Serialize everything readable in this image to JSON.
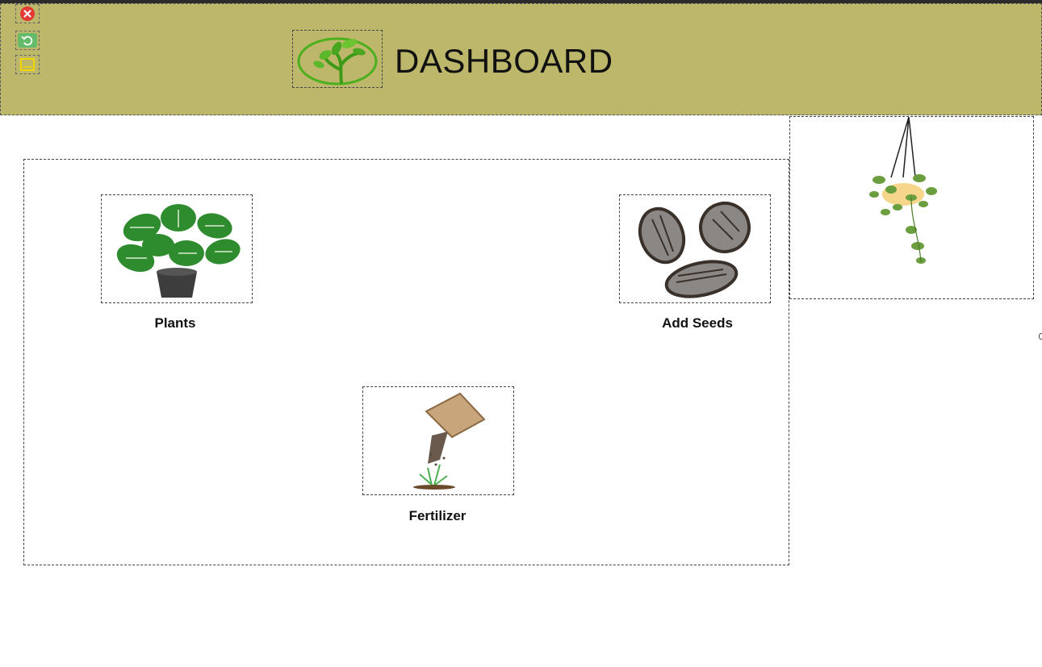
{
  "header": {
    "title": "DASHBOARD",
    "bg_color": "#bdb76c"
  },
  "window_controls": [
    {
      "name": "close-icon",
      "color": "#e53935"
    },
    {
      "name": "refresh-icon",
      "color": "#66bb6a"
    },
    {
      "name": "minimize-icon",
      "color": "#f2d600"
    }
  ],
  "tiles": [
    {
      "label": "Plants",
      "icon": "potted-plant-icon"
    },
    {
      "label": "Add Seeds",
      "icon": "seeds-icon"
    },
    {
      "label": "Fertilizer",
      "icon": "fertilizer-bag-icon"
    }
  ],
  "decoration": {
    "icon": "hanging-plant-icon"
  }
}
